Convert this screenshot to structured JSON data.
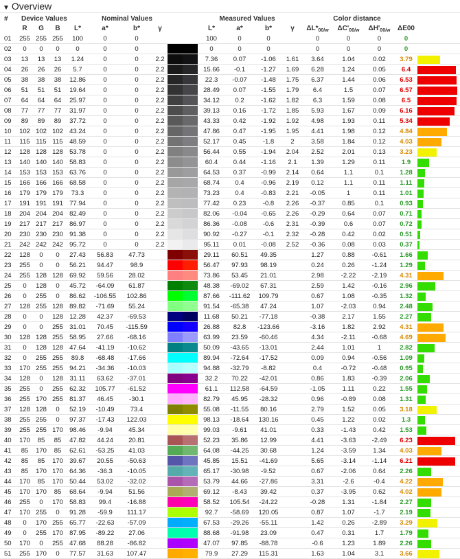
{
  "title": "Overview",
  "groups": {
    "device": "Device Values",
    "nominal": "Nominal Values",
    "measured": "Measured Values",
    "distance": "Color distance"
  },
  "columns": [
    "#",
    "R",
    "G",
    "B",
    "L*",
    "a*",
    "b*",
    "γ",
    "L*",
    "a*",
    "b*",
    "γ",
    "ΔL*00/w",
    "ΔC'00/w",
    "ΔH'00/w",
    "ΔE00"
  ],
  "rows": [
    [
      "01",
      "255",
      "255",
      "255",
      "100",
      "0",
      "0",
      "",
      "100",
      "0",
      "0",
      "",
      "0",
      "0",
      "0",
      "0"
    ],
    [
      "02",
      "0",
      "0",
      "0",
      "0",
      "0",
      "0",
      "",
      "0",
      "0",
      "0",
      "",
      "0",
      "0",
      "0",
      "0"
    ],
    [
      "03",
      "13",
      "13",
      "13",
      "1.24",
      "0",
      "0",
      "2.2",
      "7.36",
      "0.07",
      "-1.06",
      "1.61",
      "3.64",
      "1.04",
      "0.02",
      "3.79"
    ],
    [
      "04",
      "26",
      "26",
      "26",
      "5.7",
      "0",
      "0",
      "2.2",
      "15.66",
      "-0.1",
      "-1.27",
      "1.69",
      "6.28",
      "1.24",
      "0.05",
      "6.4"
    ],
    [
      "05",
      "38",
      "38",
      "38",
      "12.86",
      "0",
      "0",
      "2.2",
      "22.3",
      "-0.07",
      "-1.48",
      "1.75",
      "6.37",
      "1.44",
      "0.06",
      "6.53"
    ],
    [
      "06",
      "51",
      "51",
      "51",
      "19.64",
      "0",
      "0",
      "2.2",
      "28.49",
      "0.07",
      "-1.55",
      "1.79",
      "6.4",
      "1.5",
      "0.07",
      "6.57"
    ],
    [
      "07",
      "64",
      "64",
      "64",
      "25.97",
      "0",
      "0",
      "2.2",
      "34.12",
      "0.2",
      "-1.62",
      "1.82",
      "6.3",
      "1.59",
      "0.08",
      "6.5"
    ],
    [
      "08",
      "77",
      "77",
      "77",
      "31.97",
      "0",
      "0",
      "2.2",
      "39.13",
      "0.16",
      "-1.72",
      "1.85",
      "5.93",
      "1.67",
      "0.09",
      "6.16"
    ],
    [
      "09",
      "89",
      "89",
      "89",
      "37.72",
      "0",
      "0",
      "2.2",
      "43.33",
      "0.42",
      "-1.92",
      "1.92",
      "4.98",
      "1.93",
      "0.11",
      "5.34"
    ],
    [
      "10",
      "102",
      "102",
      "102",
      "43.24",
      "0",
      "0",
      "2.2",
      "47.86",
      "0.47",
      "-1.95",
      "1.95",
      "4.41",
      "1.98",
      "0.12",
      "4.84"
    ],
    [
      "11",
      "115",
      "115",
      "115",
      "48.59",
      "0",
      "0",
      "2.2",
      "52.17",
      "0.45",
      "-1.8",
      "2",
      "3.58",
      "1.84",
      "0.12",
      "4.03"
    ],
    [
      "12",
      "128",
      "128",
      "128",
      "53.78",
      "0",
      "0",
      "2.2",
      "56.44",
      "0.55",
      "-1.94",
      "2.04",
      "2.52",
      "2.01",
      "0.13",
      "3.23"
    ],
    [
      "13",
      "140",
      "140",
      "140",
      "58.83",
      "0",
      "0",
      "2.2",
      "60.4",
      "0.44",
      "-1.16",
      "2.1",
      "1.39",
      "1.29",
      "0.11",
      "1.9"
    ],
    [
      "14",
      "153",
      "153",
      "153",
      "63.76",
      "0",
      "0",
      "2.2",
      "64.53",
      "0.37",
      "-0.99",
      "2.14",
      "0.64",
      "1.1",
      "0.1",
      "1.28"
    ],
    [
      "15",
      "166",
      "166",
      "166",
      "68.58",
      "0",
      "0",
      "2.2",
      "68.74",
      "0.4",
      "-0.96",
      "2.19",
      "0.12",
      "1.1",
      "0.11",
      "1.11"
    ],
    [
      "16",
      "179",
      "179",
      "179",
      "73.3",
      "0",
      "0",
      "2.2",
      "73.23",
      "0.4",
      "-0.83",
      "2.21",
      "-0.05",
      "1",
      "0.11",
      "1.01"
    ],
    [
      "17",
      "191",
      "191",
      "191",
      "77.94",
      "0",
      "0",
      "2.2",
      "77.42",
      "0.23",
      "-0.8",
      "2.26",
      "-0.37",
      "0.85",
      "0.1",
      "0.93"
    ],
    [
      "18",
      "204",
      "204",
      "204",
      "82.49",
      "0",
      "0",
      "2.2",
      "82.06",
      "-0.04",
      "-0.65",
      "2.26",
      "-0.29",
      "0.64",
      "0.07",
      "0.71"
    ],
    [
      "19",
      "217",
      "217",
      "217",
      "86.97",
      "0",
      "0",
      "2.2",
      "86.36",
      "-0.08",
      "-0.6",
      "2.31",
      "-0.39",
      "0.6",
      "0.07",
      "0.72"
    ],
    [
      "20",
      "230",
      "230",
      "230",
      "91.38",
      "0",
      "0",
      "2.2",
      "90.92",
      "-0.27",
      "-0.1",
      "2.32",
      "-0.28",
      "0.42",
      "0.02",
      "0.51"
    ],
    [
      "21",
      "242",
      "242",
      "242",
      "95.72",
      "0",
      "0",
      "2.2",
      "95.11",
      "0.01",
      "-0.08",
      "2.52",
      "-0.36",
      "0.08",
      "0.03",
      "0.37"
    ],
    [
      "22",
      "128",
      "0",
      "0",
      "27.43",
      "56.83",
      "47.73",
      "",
      "29.11",
      "60.51",
      "49.35",
      "",
      "1.27",
      "0.88",
      "-0.61",
      "1.66"
    ],
    [
      "23",
      "255",
      "0",
      "0",
      "56.21",
      "94.47",
      "98.9",
      "",
      "56.47",
      "97.93",
      "98.19",
      "",
      "0.24",
      "0.26",
      "-1.24",
      "1.29"
    ],
    [
      "24",
      "255",
      "128",
      "128",
      "69.92",
      "59.56",
      "28.02",
      "",
      "73.86",
      "53.45",
      "21.01",
      "",
      "2.98",
      "-2.22",
      "-2.19",
      "4.31"
    ],
    [
      "25",
      "0",
      "128",
      "0",
      "45.72",
      "-64.09",
      "61.87",
      "",
      "48.38",
      "-69.02",
      "67.31",
      "",
      "2.59",
      "1.42",
      "-0.16",
      "2.96"
    ],
    [
      "26",
      "0",
      "255",
      "0",
      "86.62",
      "-106.55",
      "102.86",
      "",
      "87.66",
      "-111.62",
      "109.79",
      "",
      "0.67",
      "1.08",
      "-0.35",
      "1.32"
    ],
    [
      "27",
      "128",
      "255",
      "128",
      "89.82",
      "-71.69",
      "55.24",
      "",
      "91.54",
      "-65.38",
      "47.24",
      "",
      "1.07",
      "-2.03",
      "0.94",
      "2.48"
    ],
    [
      "28",
      "0",
      "0",
      "128",
      "12.28",
      "42.37",
      "-69.53",
      "",
      "11.68",
      "50.21",
      "-77.18",
      "",
      "-0.38",
      "2.17",
      "1.55",
      "2.27"
    ],
    [
      "29",
      "0",
      "0",
      "255",
      "31.01",
      "70.45",
      "-115.59",
      "",
      "26.88",
      "82.8",
      "-123.66",
      "",
      "-3.16",
      "1.82",
      "2.92",
      "4.31"
    ],
    [
      "30",
      "128",
      "128",
      "255",
      "58.95",
      "27.66",
      "-68.16",
      "",
      "63.99",
      "23.59",
      "-60.46",
      "",
      "4.34",
      "-2.11",
      "-0.68",
      "4.69"
    ],
    [
      "31",
      "0",
      "128",
      "128",
      "47.64",
      "-41.19",
      "-10.62",
      "",
      "50.09",
      "-43.65",
      "-13.01",
      "",
      "2.44",
      "1.01",
      "1",
      "2.82"
    ],
    [
      "32",
      "0",
      "255",
      "255",
      "89.8",
      "-68.48",
      "-17.66",
      "",
      "89.94",
      "-72.64",
      "-17.52",
      "",
      "0.09",
      "0.94",
      "-0.56",
      "1.09"
    ],
    [
      "33",
      "170",
      "255",
      "255",
      "94.21",
      "-34.36",
      "-10.03",
      "",
      "94.88",
      "-32.79",
      "-8.82",
      "",
      "0.4",
      "-0.72",
      "-0.48",
      "0.95"
    ],
    [
      "34",
      "128",
      "0",
      "128",
      "31.11",
      "63.62",
      "-37.01",
      "",
      "32.2",
      "70.22",
      "-42.01",
      "",
      "0.86",
      "1.83",
      "-0.39",
      "2.06"
    ],
    [
      "35",
      "255",
      "0",
      "255",
      "62.32",
      "105.77",
      "-61.52",
      "",
      "61.1",
      "112.58",
      "-64.59",
      "",
      "-1.05",
      "1.11",
      "0.22",
      "1.55"
    ],
    [
      "36",
      "255",
      "170",
      "255",
      "81.37",
      "46.45",
      "-30.1",
      "",
      "82.79",
      "45.95",
      "-28.32",
      "",
      "0.96",
      "-0.89",
      "0.08",
      "1.31"
    ],
    [
      "37",
      "128",
      "128",
      "0",
      "52.19",
      "-10.49",
      "73.4",
      "",
      "55.08",
      "-11.55",
      "80.16",
      "",
      "2.79",
      "1.52",
      "0.05",
      "3.18"
    ],
    [
      "38",
      "255",
      "255",
      "0",
      "97.37",
      "-17.43",
      "122.03",
      "",
      "98.13",
      "-18.64",
      "130.16",
      "",
      "0.45",
      "1.22",
      "0.02",
      "1.3"
    ],
    [
      "39",
      "255",
      "255",
      "170",
      "98.46",
      "-9.94",
      "45.34",
      "",
      "99.03",
      "-9.61",
      "41.01",
      "",
      "0.33",
      "-1.43",
      "0.42",
      "1.53"
    ],
    [
      "40",
      "170",
      "85",
      "85",
      "47.82",
      "44.24",
      "20.81",
      "",
      "52.23",
      "35.86",
      "12.99",
      "",
      "4.41",
      "-3.63",
      "-2.49",
      "6.23"
    ],
    [
      "41",
      "85",
      "170",
      "85",
      "62.61",
      "-53.25",
      "41.03",
      "",
      "64.08",
      "-44.25",
      "30.68",
      "",
      "1.24",
      "-3.59",
      "1.34",
      "4.03"
    ],
    [
      "42",
      "85",
      "85",
      "170",
      "39.67",
      "20.55",
      "-50.63",
      "",
      "45.85",
      "15.51",
      "-41.69",
      "",
      "5.65",
      "-3.14",
      "-1.14",
      "6.21"
    ],
    [
      "43",
      "85",
      "170",
      "170",
      "64.36",
      "-36.3",
      "-10.05",
      "",
      "65.17",
      "-30.98",
      "-9.52",
      "",
      "0.67",
      "-2.06",
      "0.64",
      "2.26"
    ],
    [
      "44",
      "170",
      "85",
      "170",
      "50.44",
      "53.02",
      "-32.02",
      "",
      "53.79",
      "44.66",
      "-27.86",
      "",
      "3.31",
      "-2.6",
      "-0.4",
      "4.22"
    ],
    [
      "45",
      "170",
      "170",
      "85",
      "68.64",
      "-9.94",
      "51.56",
      "",
      "69.12",
      "-8.43",
      "39.42",
      "",
      "0.37",
      "-3.95",
      "0.62",
      "4.02"
    ],
    [
      "46",
      "255",
      "0",
      "170",
      "58.83",
      "99.4",
      "-16.88",
      "",
      "58.52",
      "105.54",
      "-24.22",
      "",
      "-0.28",
      "1.31",
      "-1.84",
      "2.27"
    ],
    [
      "47",
      "170",
      "255",
      "0",
      "91.28",
      "-59.9",
      "111.17",
      "",
      "92.7",
      "-58.69",
      "120.05",
      "",
      "0.87",
      "1.07",
      "-1.7",
      "2.19"
    ],
    [
      "48",
      "0",
      "170",
      "255",
      "65.77",
      "-22.63",
      "-57.09",
      "",
      "67.53",
      "-29.26",
      "-55.11",
      "",
      "1.42",
      "0.26",
      "-2.89",
      "3.29"
    ],
    [
      "49",
      "0",
      "255",
      "170",
      "87.95",
      "-89.22",
      "27.06",
      "",
      "88.68",
      "-91.98",
      "23.09",
      "",
      "0.47",
      "0.31",
      "1.7",
      "1.79"
    ],
    [
      "50",
      "170",
      "0",
      "255",
      "47.68",
      "88.28",
      "-86.82",
      "",
      "47.07",
      "97.85",
      "-88.78",
      "",
      "-0.6",
      "1.23",
      "1.89",
      "2.26"
    ],
    [
      "51",
      "255",
      "170",
      "0",
      "77.57",
      "31.63",
      "107.47",
      "",
      "79.9",
      "27.29",
      "115.31",
      "",
      "1.63",
      "1.04",
      "3.1",
      "3.66"
    ]
  ],
  "swatches": {
    "nominal": [
      "#ffffff",
      "#000000",
      "#0d0d0d",
      "#1a1a1a",
      "#262626",
      "#333333",
      "#404040",
      "#4d4d4d",
      "#595959",
      "#666666",
      "#737373",
      "#808080",
      "#8c8c8c",
      "#999999",
      "#a6a6a6",
      "#b3b3b3",
      "#bfbfbf",
      "#cccccc",
      "#d9d9d9",
      "#e6e6e6",
      "#f2f2f2",
      "#800000",
      "#ff0000",
      "#ff8080",
      "#008000",
      "#00ff00",
      "#80ff80",
      "#000080",
      "#0000ff",
      "#8080ff",
      "#008080",
      "#00ffff",
      "#aaffff",
      "#800080",
      "#ff00ff",
      "#ffaaff",
      "#808000",
      "#ffff00",
      "#ffffaa",
      "#aa5555",
      "#55aa55",
      "#5555aa",
      "#55aaaa",
      "#aa55aa",
      "#aaaa55",
      "#ff00aa",
      "#aaff00",
      "#00aaff",
      "#00ffaa",
      "#aa00ff",
      "#ffaa00"
    ],
    "measured": [
      "#ffffff",
      "#000000",
      "#121214",
      "#262629",
      "#37373b",
      "#46464a",
      "#545458",
      "#5f5f63",
      "#69696d",
      "#747478",
      "#7e7e82",
      "#89898d",
      "#949498",
      "#9e9ea1",
      "#a8a8ab",
      "#b2b2b5",
      "#bdbdc0",
      "#c8c8ca",
      "#d3d3d5",
      "#dedee0",
      "#eaeaec",
      "#8a0f08",
      "#ff1f00",
      "#ff8a80",
      "#0e8a10",
      "#00ff30",
      "#90ff90",
      "#00005f",
      "#1400ff",
      "#9a9aff",
      "#0a8a8e",
      "#00ffff",
      "#b8ffff",
      "#8a008e",
      "#ff00ff",
      "#ffb4ff",
      "#8f8c00",
      "#ffff00",
      "#ffffb0",
      "#b87070",
      "#70b870",
      "#6e74c0",
      "#62b4b8",
      "#b46cb8",
      "#b0b070",
      "#ff00b8",
      "#b0ff00",
      "#00b0ff",
      "#00ffb0",
      "#b000ff",
      "#ffb000"
    ]
  },
  "colors": {
    "good": "#2a9a2a",
    "warn": "#d58a00",
    "bad": "#e10000",
    "barGreen": "#33dd00",
    "barYellow": "#f2f200",
    "barOrange": "#ffaa00",
    "barRed": "#ee0000"
  }
}
